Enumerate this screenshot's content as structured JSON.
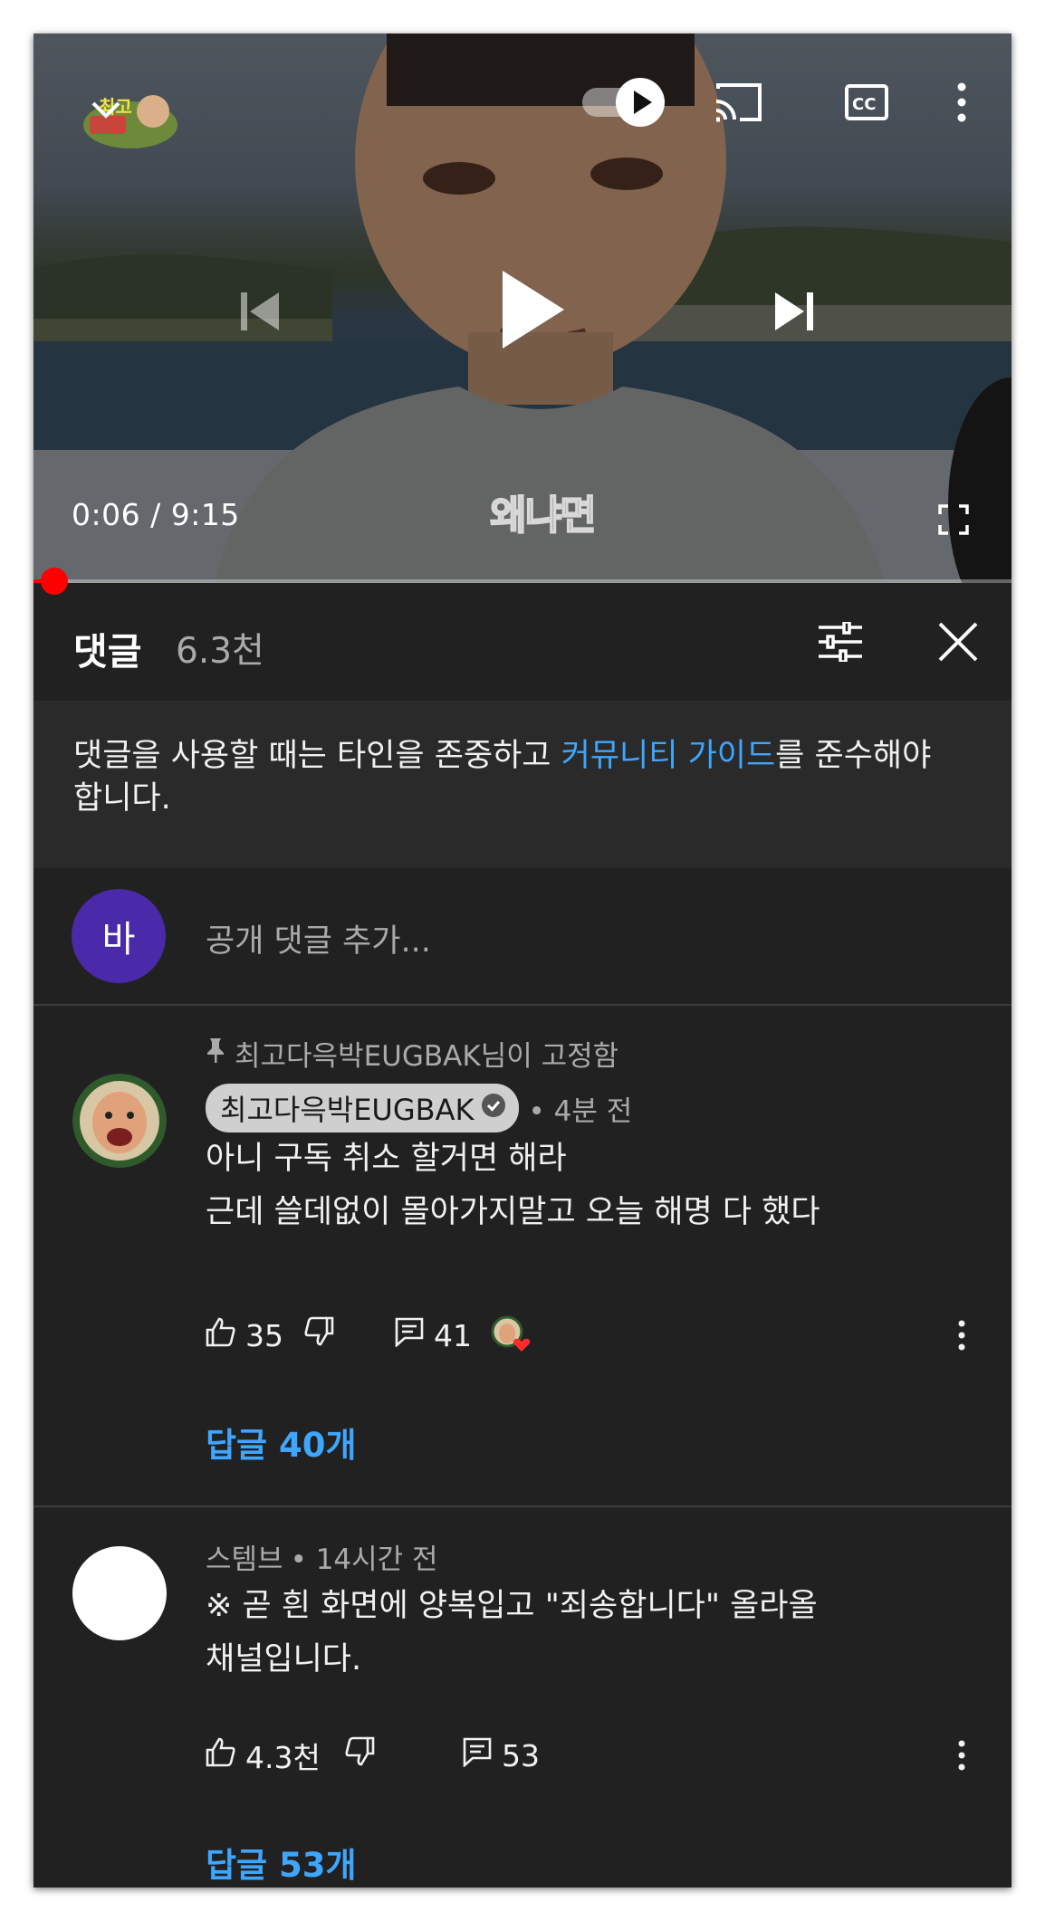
{
  "player": {
    "time_current": "0:06",
    "time_total": "9:15",
    "time_display": "0:06 / 9:15",
    "subtitle": "왜냐면",
    "progress_fraction": 0.011,
    "autoplay_on": true
  },
  "comments_panel": {
    "title": "댓글",
    "count": "6.3천",
    "guideline_text": "댓글을 사용할 때는 타인을 존중하고 ",
    "guideline_link": "커뮤니티 가이드",
    "guideline_suffix": "를 준수해야 합니다.",
    "user_avatar_letter": "바",
    "add_placeholder": "공개 댓글 추가..."
  },
  "comments": [
    {
      "pinned_label": "최고다윽박EUGBAK님이 고정함",
      "author": "최고다윽박EUGBAK",
      "verified": true,
      "time": "• 4분 전",
      "lines": [
        "아니 구독 취소 할거면 해라",
        "근데 쓸데없이 몰아가지말고 오늘 해명 다 했다"
      ],
      "likes": "35",
      "reply_count": "41",
      "creator_hearted": true,
      "replies_label": "답글 40개"
    },
    {
      "author": "스템브",
      "time": "• 14시간 전",
      "lines": [
        "※ 곧 흰 화면에 양복입고 \"죄송합니다\" 올라올",
        "채널입니다."
      ],
      "likes": "4.3천",
      "reply_count": "53",
      "replies_label": "답글 53개"
    }
  ],
  "colors": {
    "background": "#212121",
    "link": "#3ea6ff",
    "progress": "#ff0000",
    "avatar_me": "#4a2aa8"
  },
  "icons": [
    "collapse-icon",
    "channel-logo",
    "autoplay-toggle",
    "cast-icon",
    "captions-icon",
    "more-icon",
    "previous-icon",
    "play-icon",
    "next-icon",
    "fullscreen-icon",
    "filter-icon",
    "close-icon",
    "pin-icon",
    "verified-icon",
    "like-icon",
    "dislike-icon",
    "reply-icon",
    "heart-icon"
  ]
}
